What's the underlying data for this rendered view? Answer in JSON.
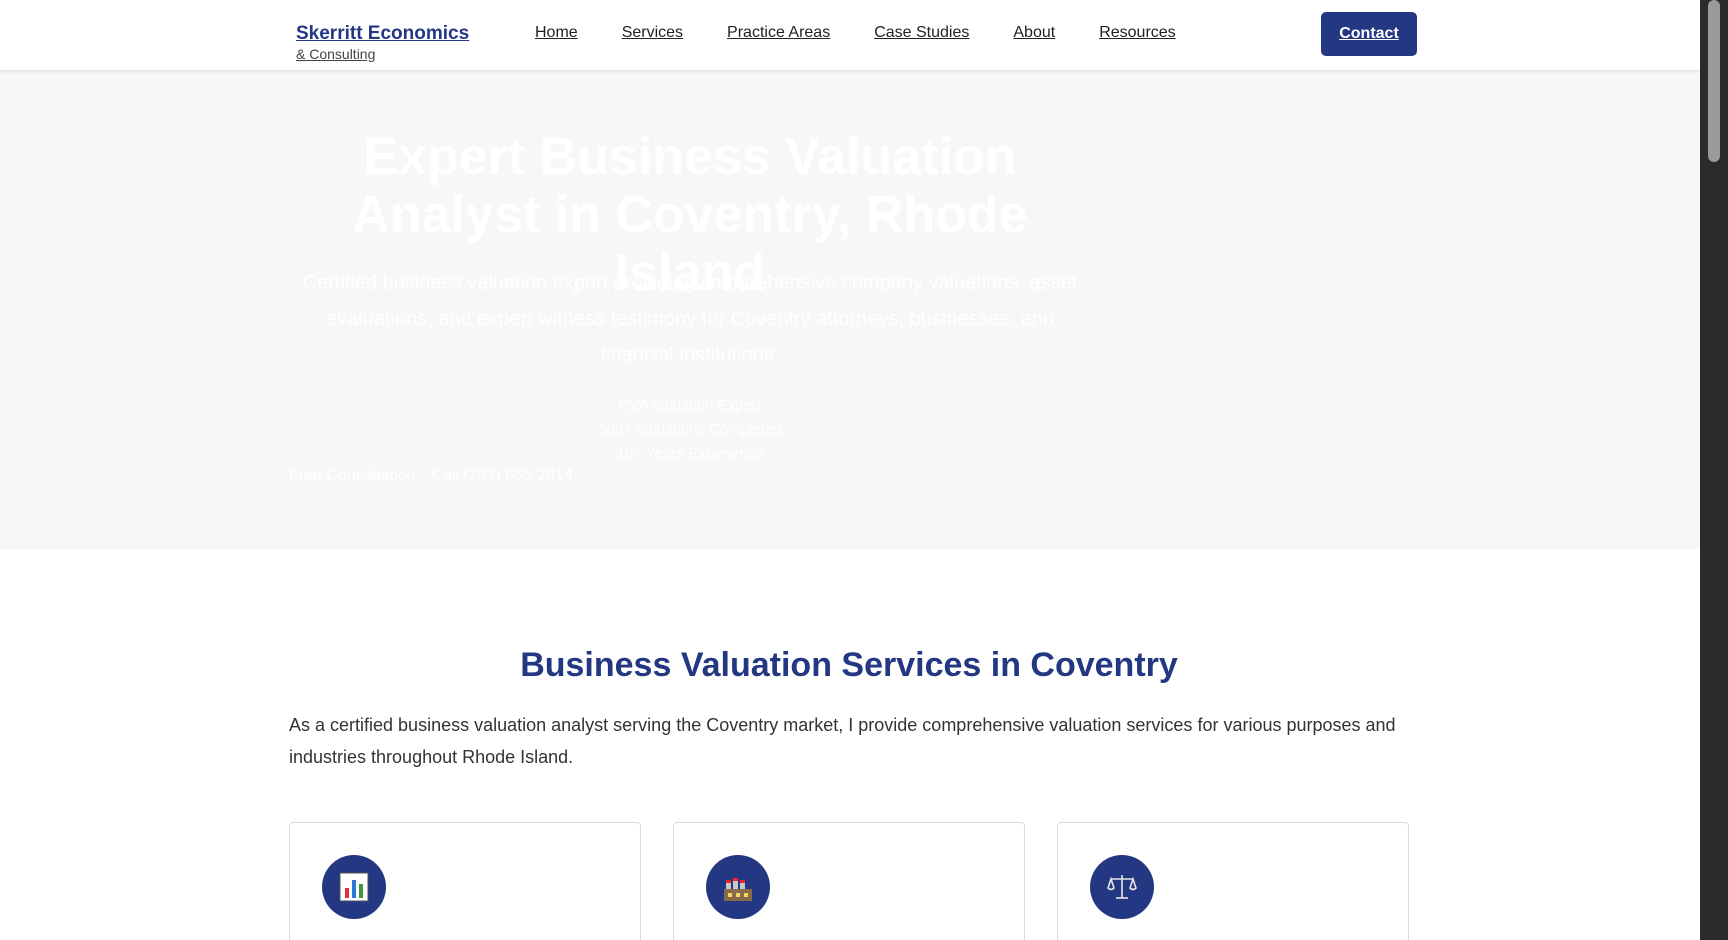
{
  "header": {
    "brand_name": "Skerritt Economics",
    "brand_sub": "& Consulting",
    "nav": [
      {
        "label": "Home"
      },
      {
        "label": "Services"
      },
      {
        "label": "Practice Areas"
      },
      {
        "label": "Case Studies"
      },
      {
        "label": "About"
      },
      {
        "label": "Resources"
      }
    ],
    "contact_label": "Contact"
  },
  "hero": {
    "title_line1": "Expert Business Valuation",
    "title_line2": "Analyst in Coventry, Rhode Island",
    "subtitle": "Certified business valuation expert providing comprehensive company valuations, asset evaluations, and expert witness testimony for Coventry attorneys, businesses, and financial institutions.",
    "badges": [
      "CVA Valuation Expert",
      "500+ Valuations Completed",
      "15+ Years Experience"
    ],
    "cta_primary": "Free Consultation",
    "cta_phone": "Call (203) 605-2814"
  },
  "services": {
    "title": "Business Valuation Services in Coventry",
    "intro": "As a certified business valuation analyst serving the Coventry market, I provide comprehensive valuation services for various purposes and industries throughout Rhode Island.",
    "cards": [
      {
        "icon": "bar-chart-icon"
      },
      {
        "icon": "factory-icon"
      },
      {
        "icon": "scales-icon"
      }
    ]
  },
  "colors": {
    "brand": "#243782",
    "hero_bg": "#f6f7f8"
  }
}
